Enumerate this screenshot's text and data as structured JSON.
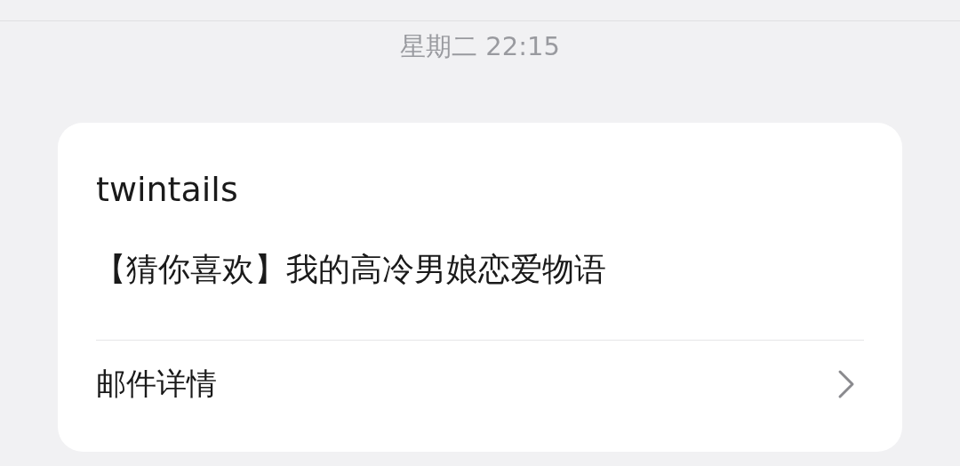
{
  "timestamp": "星期二 22:15",
  "message": {
    "sender": "twintails",
    "body": "【猜你喜欢】我的高冷男娘恋爱物语",
    "details_link": "邮件详情"
  }
}
